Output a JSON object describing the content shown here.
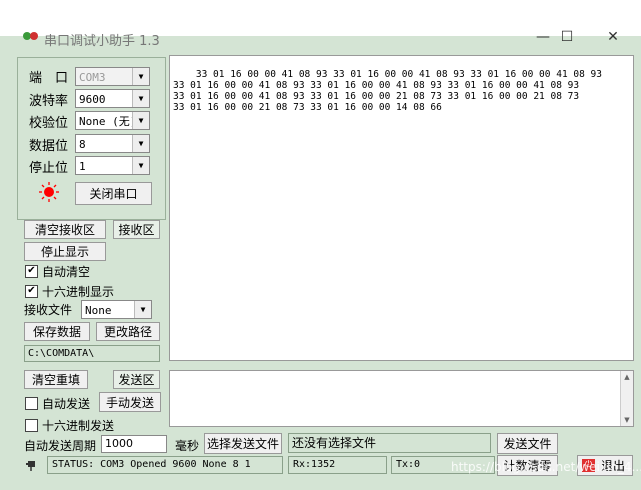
{
  "window": {
    "title": "串口调试小助手 1.3",
    "minimize": "—",
    "maximize": "☐",
    "close": "✕"
  },
  "serial_settings": {
    "port_label": "端　口",
    "port_value": "COM3",
    "baud_label": "波特率",
    "baud_value": "9600",
    "parity_label": "校验位",
    "parity_value": "None (无)",
    "databits_label": "数据位",
    "databits_value": "8",
    "stopbits_label": "停止位",
    "stopbits_value": "1",
    "open_close_label": "关闭串口",
    "indicator_color": "#ff0000"
  },
  "receive": {
    "clear_label": "清空接收区",
    "area_label": "接收区",
    "stop_display_label": "停止显示",
    "auto_clear_label": "自动清空",
    "auto_clear_checked": "✔",
    "hex_display_label": "十六进制显示",
    "hex_display_checked": "✔",
    "file_label": "接收文件",
    "file_value": "None",
    "save_label": "保存数据",
    "change_path_label": "更改路径",
    "path": "C:\\COMDATA\\",
    "content": "33 01 16 00 00 41 08 93 33 01 16 00 00 41 08 93 33 01 16 00 00 41 08 93\n33 01 16 00 00 41 08 93 33 01 16 00 00 41 08 93 33 01 16 00 00 41 08 93\n33 01 16 00 00 41 08 93 33 01 16 00 00 21 08 73 33 01 16 00 00 21 08 73\n33 01 16 00 00 21 08 73 33 01 16 00 00 14 08 66"
  },
  "send": {
    "clear_label": "清空重填",
    "area_label": "发送区",
    "auto_send_label": "自动发送",
    "manual_send_label": "手动发送",
    "hex_send_label": "十六进制发送",
    "period_label": "自动发送周期",
    "period_value": "1000",
    "ms_label": "毫秒",
    "choose_file_label": "选择发送文件",
    "file_status": "还没有选择文件",
    "send_file_label": "发送文件",
    "reset_count_label": "计数清零",
    "exit_label": "退出"
  },
  "status": {
    "text": "STATUS: COM3 Opened 9600 None  8 1",
    "rx": "Rx:1352",
    "tx": "Tx:0",
    "watermark": "https://blog.csdn.net/weixin_4..."
  }
}
